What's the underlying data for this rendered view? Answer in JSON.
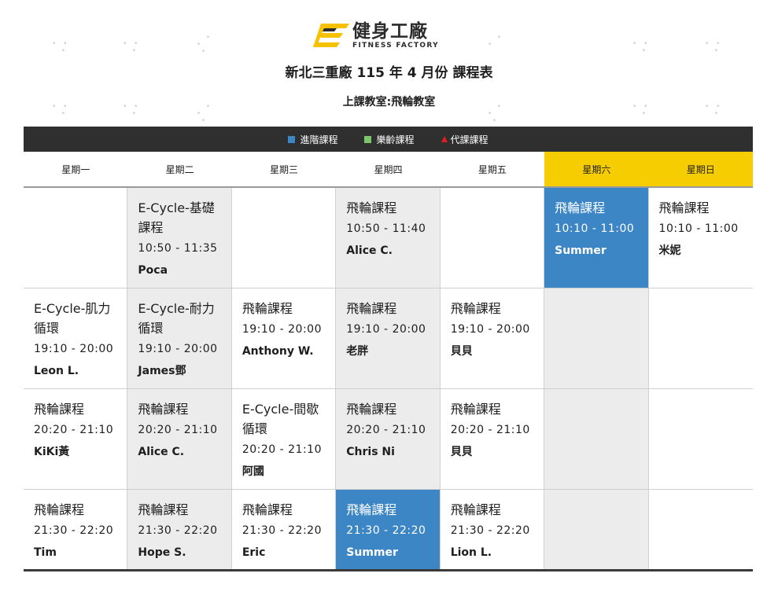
{
  "header": {
    "brand_cn": "健身工廠",
    "brand_en": "FITNESS FACTORY",
    "title": "新北三重廠 115 年 4 月份 課程表",
    "subtitle": "上課教室:飛輪教室"
  },
  "legend": [
    {
      "label": "進階課程",
      "color": "#3d86c6",
      "shape": "square"
    },
    {
      "label": "樂齡課程",
      "color": "#7cc66a",
      "shape": "square"
    },
    {
      "label": "代課課程",
      "color": "#e02020",
      "shape": "triangle"
    }
  ],
  "days": [
    {
      "label": "星期一",
      "weekend": false
    },
    {
      "label": "星期二",
      "weekend": false
    },
    {
      "label": "星期三",
      "weekend": false
    },
    {
      "label": "星期四",
      "weekend": false
    },
    {
      "label": "星期五",
      "weekend": false
    },
    {
      "label": "星期六",
      "weekend": true
    },
    {
      "label": "星期日",
      "weekend": true
    }
  ],
  "colors": {
    "advanced": "#3d86c6",
    "weekend_header": "#f6cd00",
    "legend_bar": "#2f2f2f"
  },
  "schedule": [
    [
      null,
      {
        "name": "E-Cycle-基礎課程",
        "time": "10:50 - 11:35",
        "teacher": "Poca",
        "style": "gray"
      },
      null,
      {
        "name": "飛輪課程",
        "time": "10:50 - 11:40",
        "teacher": "Alice C.",
        "style": "gray"
      },
      null,
      {
        "name": "飛輪課程",
        "time": "10:10 - 11:00",
        "teacher": "Summer",
        "style": "blue"
      },
      {
        "name": "飛輪課程",
        "time": "10:10 - 11:00",
        "teacher": "米妮",
        "style": "white"
      }
    ],
    [
      {
        "name": "E-Cycle-肌力循環",
        "time": "19:10 - 20:00",
        "teacher": "Leon L.",
        "style": "white"
      },
      {
        "name": "E-Cycle-耐力循環",
        "time": "19:10 - 20:00",
        "teacher": "James鄧",
        "style": "gray"
      },
      {
        "name": "飛輪課程",
        "time": "19:10 - 20:00",
        "teacher": "Anthony W.",
        "style": "white"
      },
      {
        "name": "飛輪課程",
        "time": "19:10 - 20:00",
        "teacher": "老胖",
        "style": "gray"
      },
      {
        "name": "飛輪課程",
        "time": "19:10 - 20:00",
        "teacher": "貝貝",
        "style": "white"
      },
      {
        "empty": true,
        "style": "gray"
      },
      null
    ],
    [
      {
        "name": "飛輪課程",
        "time": "20:20 - 21:10",
        "teacher": "KiKi黃",
        "style": "white"
      },
      {
        "name": "飛輪課程",
        "time": "20:20 - 21:10",
        "teacher": "Alice C.",
        "style": "gray"
      },
      {
        "name": "E-Cycle-間歇循環",
        "time": "20:20 - 21:10",
        "teacher": "阿國",
        "style": "white"
      },
      {
        "name": "飛輪課程",
        "time": "20:20 - 21:10",
        "teacher": "Chris Ni",
        "style": "gray"
      },
      {
        "name": "飛輪課程",
        "time": "20:20 - 21:10",
        "teacher": "貝貝",
        "style": "white"
      },
      {
        "empty": true,
        "style": "gray"
      },
      null
    ],
    [
      {
        "name": "飛輪課程",
        "time": "21:30 - 22:20",
        "teacher": "Tim",
        "style": "white"
      },
      {
        "name": "飛輪課程",
        "time": "21:30 - 22:20",
        "teacher": "Hope S.",
        "style": "gray"
      },
      {
        "name": "飛輪課程",
        "time": "21:30 - 22:20",
        "teacher": "Eric",
        "style": "white"
      },
      {
        "name": "飛輪課程",
        "time": "21:30 - 22:20",
        "teacher": "Summer",
        "style": "blue"
      },
      {
        "name": "飛輪課程",
        "time": "21:30 - 22:20",
        "teacher": "Lion L.",
        "style": "white"
      },
      {
        "empty": true,
        "style": "gray"
      },
      null
    ]
  ]
}
